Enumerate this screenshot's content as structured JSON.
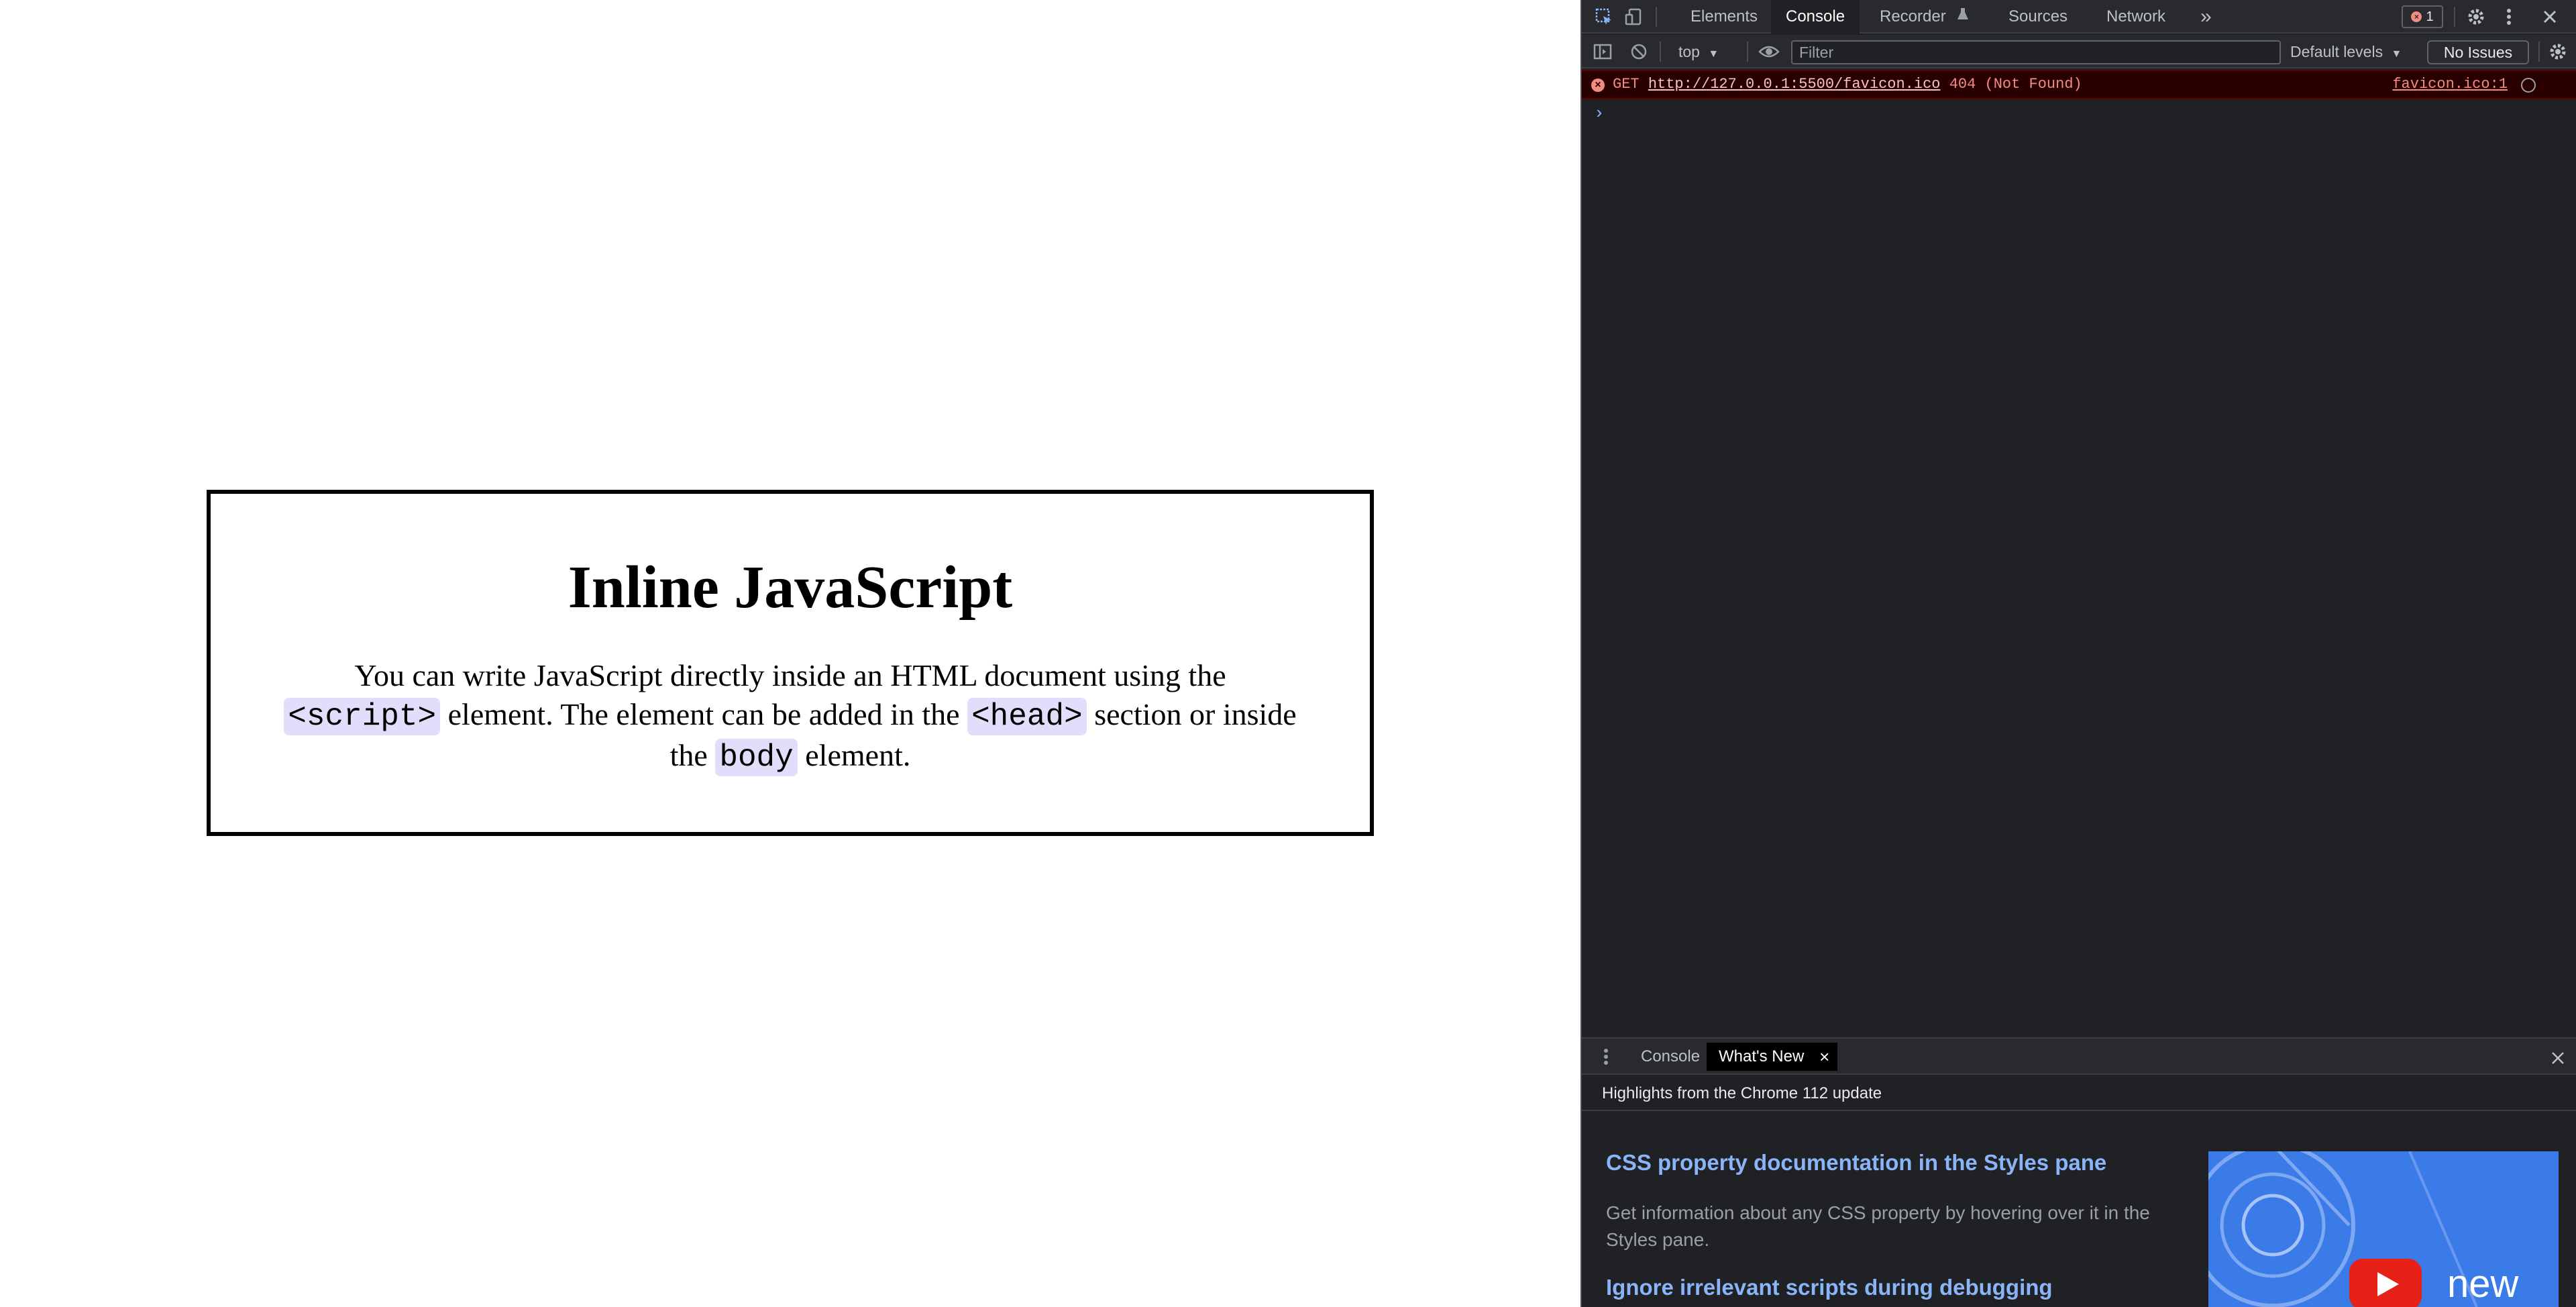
{
  "page": {
    "heading": "Inline JavaScript",
    "para_1": "You can write JavaScript directly inside an HTML document using the",
    "code_1": "<script>",
    "para_2": "element. The element can be added in the",
    "code_2": "<head>",
    "para_3": "section or inside the",
    "code_3": "body",
    "para_4": "element."
  },
  "devtools": {
    "tabs": [
      "Elements",
      "Console",
      "Recorder",
      "Sources",
      "Network"
    ],
    "active_tab": "Console",
    "more_tabs": "»",
    "error_count": "1",
    "toolbar": {
      "context": "top",
      "filter_placeholder": "Filter",
      "levels": "Default levels",
      "issues": "No Issues"
    },
    "error": {
      "method": "GET",
      "url": "http://127.0.0.1:5500/favicon.ico",
      "status": "404 (Not Found)",
      "source": "favicon.ico:1"
    },
    "prompt": "›",
    "drawer": {
      "tabs": [
        "Console",
        "What's New"
      ],
      "active_tab": "What's New",
      "highlights": "Highlights from the Chrome 112 update",
      "items": [
        {
          "title": "CSS property documentation in the Styles pane",
          "desc": "Get information about any CSS property by hovering over it in the Styles pane."
        },
        {
          "title": "Ignore irrelevant scripts during debugging"
        }
      ],
      "video_label": "new"
    },
    "colors": {
      "accent": "#8ab4f8",
      "error": "#f28b82",
      "code_bg": "#e3dcfb"
    }
  }
}
